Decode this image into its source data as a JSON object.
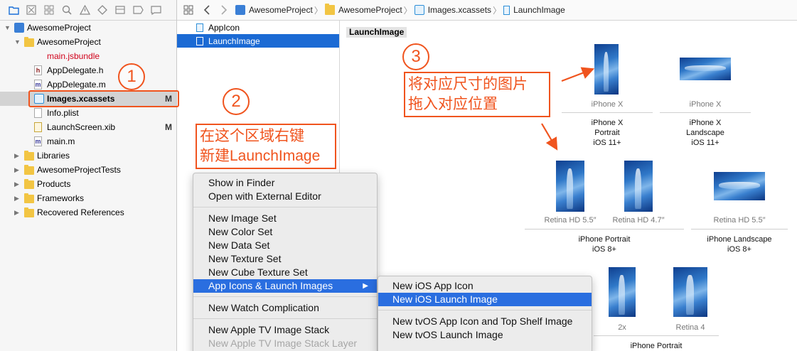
{
  "breadcrumb": [
    "AwesomeProject",
    "AwesomeProject",
    "Images.xcassets",
    "LaunchImage"
  ],
  "navigator": {
    "toolbar_icons": [
      "folder-icon",
      "source-control-icon",
      "symbol-icon",
      "search-icon",
      "warning-icon",
      "test-icon",
      "debug-icon",
      "breakpoint-icon",
      "report-icon"
    ],
    "items": [
      {
        "label": "AwesomeProject",
        "depth": 0,
        "disclosure": "open",
        "icon": "project-icon",
        "badge": ""
      },
      {
        "label": "AwesomeProject",
        "depth": 1,
        "disclosure": "open",
        "icon": "folder-icon",
        "badge": ""
      },
      {
        "label": "main.jsbundle",
        "depth": 2,
        "disclosure": "",
        "icon": "",
        "badge": "",
        "color": "#d0021b"
      },
      {
        "label": "AppDelegate.h",
        "depth": 2,
        "disclosure": "",
        "icon": "header-file-icon",
        "badge": "",
        "glyph": "h"
      },
      {
        "label": "AppDelegate.m",
        "depth": 2,
        "disclosure": "",
        "icon": "objc-file-icon",
        "badge": "",
        "glyph": "m"
      },
      {
        "label": "Images.xcassets",
        "depth": 2,
        "disclosure": "",
        "icon": "asset-catalog-icon",
        "badge": "M",
        "selected": true
      },
      {
        "label": "Info.plist",
        "depth": 2,
        "disclosure": "",
        "icon": "plist-file-icon",
        "badge": ""
      },
      {
        "label": "LaunchScreen.xib",
        "depth": 2,
        "disclosure": "",
        "icon": "xib-file-icon",
        "badge": "M"
      },
      {
        "label": "main.m",
        "depth": 2,
        "disclosure": "",
        "icon": "objc-file-icon",
        "badge": "",
        "glyph": "m"
      },
      {
        "label": "Libraries",
        "depth": 1,
        "disclosure": "closed",
        "icon": "folder-icon",
        "badge": ""
      },
      {
        "label": "AwesomeProjectTests",
        "depth": 1,
        "disclosure": "closed",
        "icon": "folder-icon",
        "badge": ""
      },
      {
        "label": "Products",
        "depth": 1,
        "disclosure": "closed",
        "icon": "folder-icon",
        "badge": ""
      },
      {
        "label": "Frameworks",
        "depth": 1,
        "disclosure": "closed",
        "icon": "folder-icon",
        "badge": ""
      },
      {
        "label": "Recovered References",
        "depth": 1,
        "disclosure": "closed",
        "icon": "folder-icon",
        "badge": ""
      }
    ]
  },
  "asset_list": [
    {
      "label": "AppIcon",
      "selected": false
    },
    {
      "label": "LaunchImage",
      "selected": true
    }
  ],
  "editor": {
    "title": "LaunchImage",
    "slots": [
      {
        "label": "iPhone X"
      },
      {
        "label": "iPhone X"
      },
      {
        "label": "Retina HD 5.5″"
      },
      {
        "label": "Retina HD 4.7″"
      },
      {
        "label": "Retina HD 5.5″"
      },
      {
        "label": "2x"
      },
      {
        "label": "Retina 4"
      }
    ],
    "groups": [
      "iPhone X\nPortrait\niOS 11+",
      "iPhone X\nLandscape\niOS 11+",
      "iPhone Portrait\niOS 8+",
      "iPhone Landscape\niOS 8+",
      "iPhone Portrait"
    ]
  },
  "context_menu": {
    "items": [
      {
        "label": "Show in Finder"
      },
      {
        "label": "Open with External Editor"
      },
      {
        "label": "New Image Set"
      },
      {
        "label": "New Color Set"
      },
      {
        "label": "New Data Set"
      },
      {
        "label": "New Texture Set"
      },
      {
        "label": "New Cube Texture Set"
      },
      {
        "label": "App Icons & Launch Images",
        "submenu": true,
        "highlighted": true
      },
      {
        "label": "New Watch Complication"
      },
      {
        "label": "New Apple TV Image Stack"
      },
      {
        "label": "New Apple TV Image Stack Layer",
        "disabled": true
      }
    ]
  },
  "submenu": {
    "items": [
      {
        "label": "New iOS App Icon"
      },
      {
        "label": "New iOS Launch Image",
        "highlighted": true
      },
      {
        "label": "New tvOS App Icon and Top Shelf Image"
      },
      {
        "label": "New tvOS Launch Image"
      }
    ]
  },
  "annotations": {
    "step1": "1",
    "step2": "2",
    "step3": "3",
    "note2_line1": "在这个区域右键",
    "note2_line2": "新建LaunchImage",
    "note3_line1": "将对应尺寸的图片",
    "note3_line2": "拖入对应位置",
    "color": "#f0541e"
  }
}
